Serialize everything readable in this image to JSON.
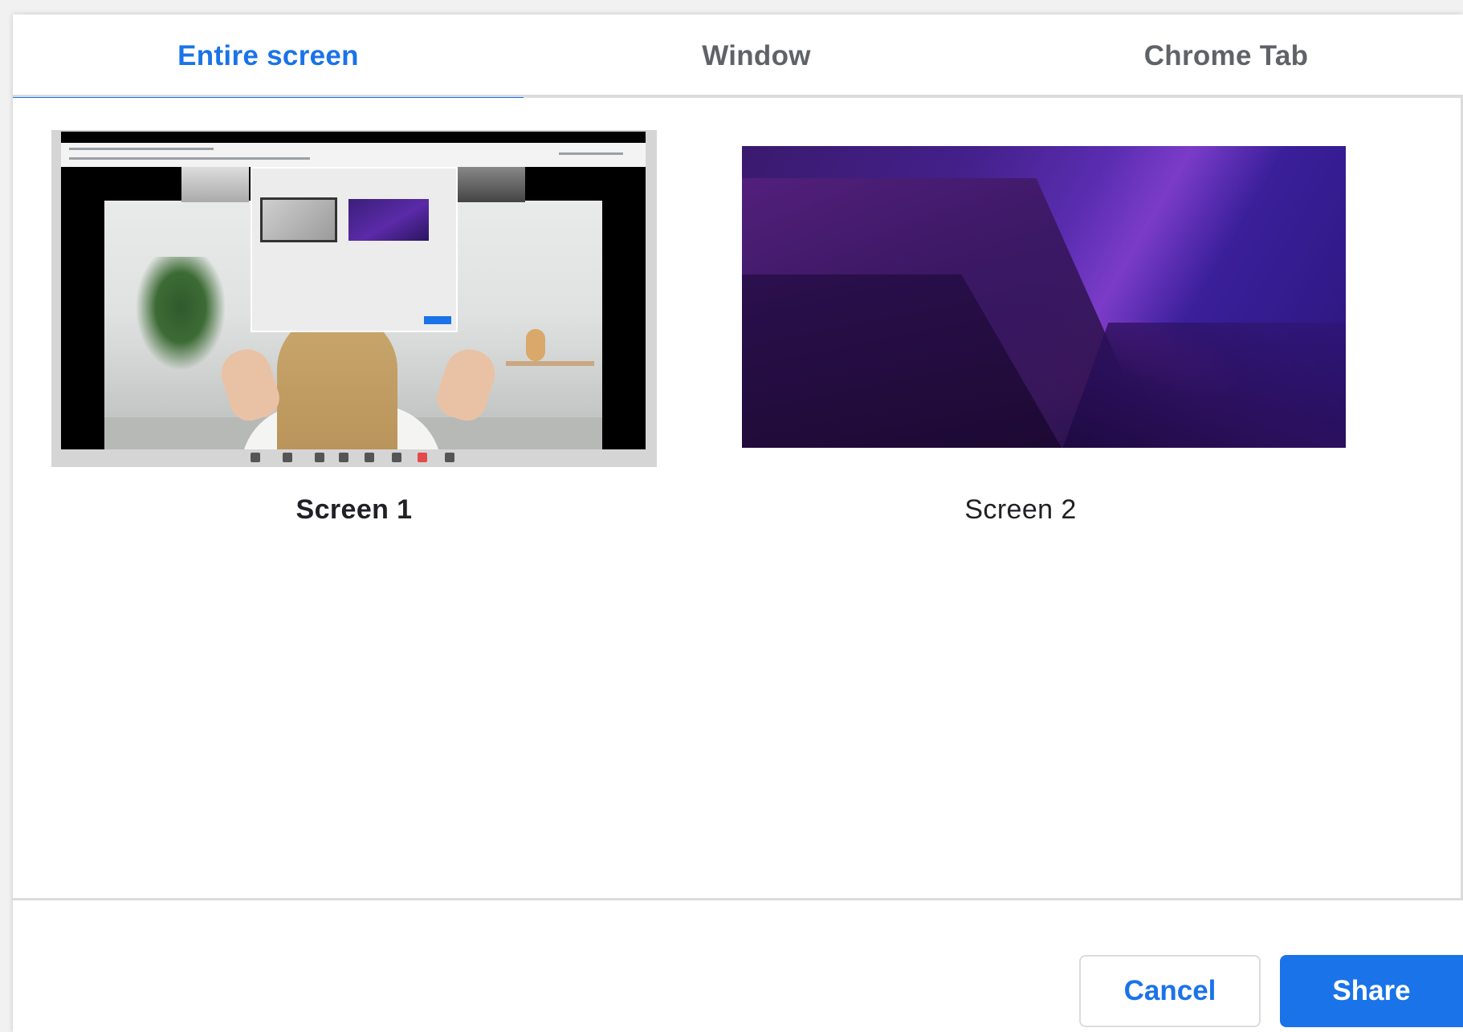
{
  "tabs": [
    {
      "label": "Entire screen",
      "active": true
    },
    {
      "label": "Window",
      "active": false
    },
    {
      "label": "Chrome Tab",
      "active": false
    }
  ],
  "sources": [
    {
      "label": "Screen 1",
      "selected": true
    },
    {
      "label": "Screen 2",
      "selected": false
    }
  ],
  "actions": {
    "cancel_label": "Cancel",
    "share_label": "Share"
  },
  "colors": {
    "accent": "#1a73e8",
    "tab_inactive": "#5f6368",
    "text": "#202124"
  }
}
